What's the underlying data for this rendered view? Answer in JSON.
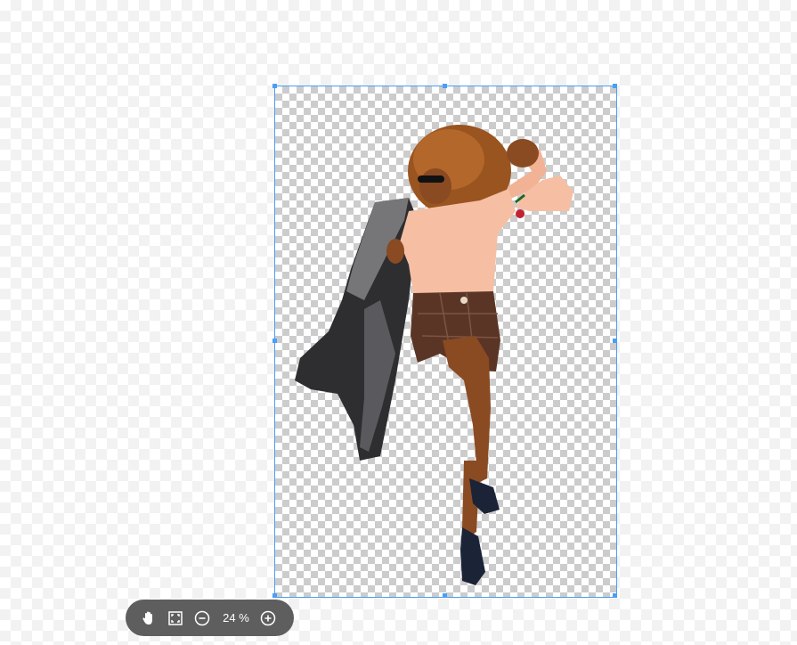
{
  "toolbar": {
    "zoom_label": "24 %",
    "buttons": [
      {
        "name": "pan",
        "icon": "hand-icon"
      },
      {
        "name": "fit",
        "icon": "fit-screen-icon"
      },
      {
        "name": "zoom-out",
        "icon": "zoom-out-icon"
      },
      {
        "name": "zoom-in",
        "icon": "zoom-in-icon"
      }
    ]
  },
  "selection": {
    "color": "#4a9ff5"
  },
  "image": {
    "description_icon": "cutout-person-image",
    "colors": {
      "sweater": "#f6bfa3",
      "skirt": "#5a3526",
      "coat": "#2e2e30",
      "hair": "#9a5420",
      "skin": "#8a4a22"
    }
  }
}
